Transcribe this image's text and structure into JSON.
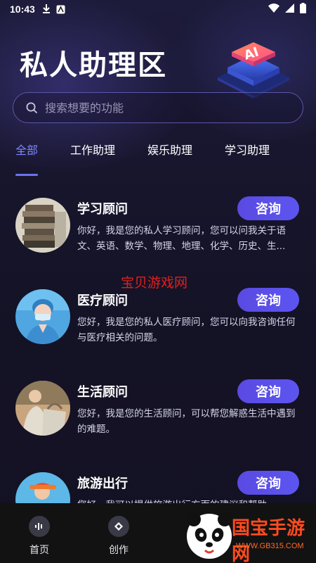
{
  "status_bar": {
    "time": "10:43"
  },
  "header": {
    "title": "私人助理区"
  },
  "search": {
    "placeholder": "搜索想要的功能"
  },
  "tabs": [
    {
      "label": "全部",
      "active": true
    },
    {
      "label": "工作助理",
      "active": false
    },
    {
      "label": "娱乐助理",
      "active": false
    },
    {
      "label": "学习助理",
      "active": false
    }
  ],
  "assistants": [
    {
      "title": "学习顾问",
      "desc": "你好，我是您的私人学习顾问，您可以问我关于语文、英语、数学、物理、地理、化学、历史、生...",
      "button": "咨询"
    },
    {
      "title": "医疗顾问",
      "desc": "您好，我是您的私人医疗顾问，您可以向我咨询任何与医疗相关的问题。",
      "button": "咨询"
    },
    {
      "title": "生活顾问",
      "desc": "您好，我是您的生活顾问，可以帮您解惑生活中遇到的难题。",
      "button": "咨询"
    },
    {
      "title": "旅游出行",
      "desc": "您好，我可以提供旅游出行方面的建议和帮助。",
      "button": "咨询"
    }
  ],
  "watermark": "宝贝游戏网",
  "bottom_nav": [
    {
      "label": "首页"
    },
    {
      "label": "创作"
    }
  ],
  "brand": {
    "name": "国宝手游网",
    "url": "WWW.GB315.COM"
  },
  "colors": {
    "accent": "#7f88ff",
    "button": "#5a4ae2",
    "background": "#17152b"
  }
}
